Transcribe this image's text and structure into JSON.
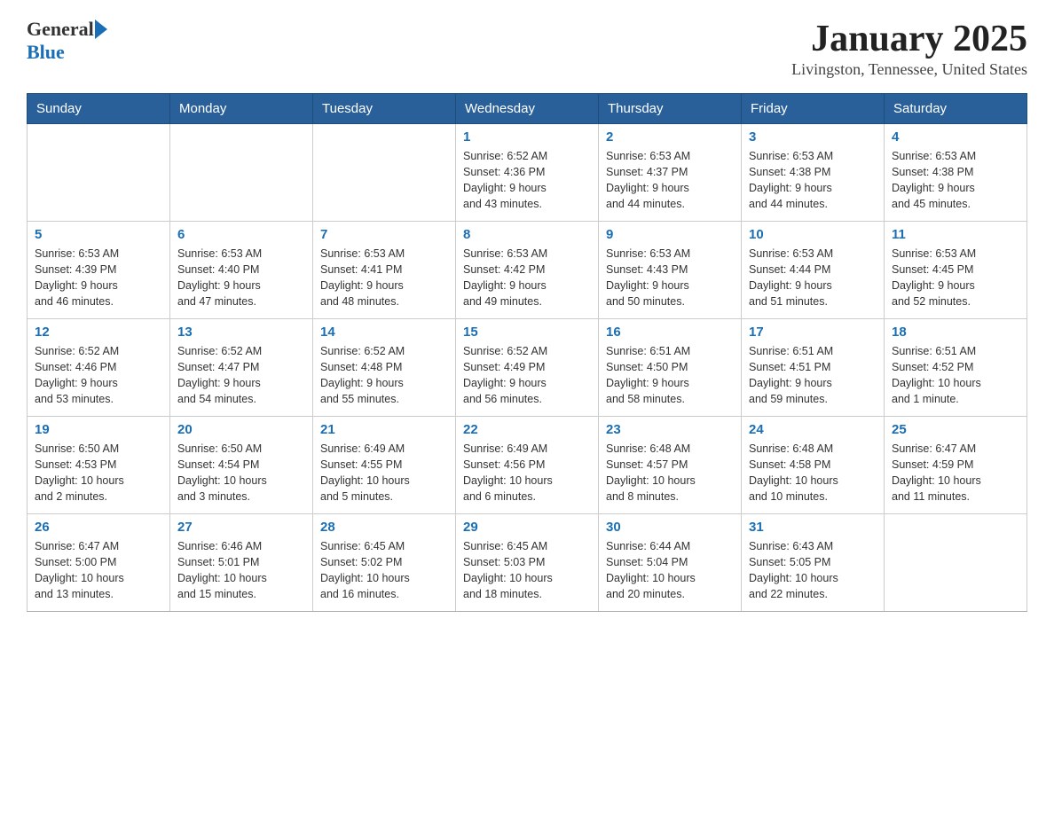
{
  "header": {
    "logo_general": "General",
    "logo_blue": "Blue",
    "title": "January 2025",
    "subtitle": "Livingston, Tennessee, United States"
  },
  "weekdays": [
    "Sunday",
    "Monday",
    "Tuesday",
    "Wednesday",
    "Thursday",
    "Friday",
    "Saturday"
  ],
  "weeks": [
    [
      {
        "day": "",
        "info": ""
      },
      {
        "day": "",
        "info": ""
      },
      {
        "day": "",
        "info": ""
      },
      {
        "day": "1",
        "info": "Sunrise: 6:52 AM\nSunset: 4:36 PM\nDaylight: 9 hours\nand 43 minutes."
      },
      {
        "day": "2",
        "info": "Sunrise: 6:53 AM\nSunset: 4:37 PM\nDaylight: 9 hours\nand 44 minutes."
      },
      {
        "day": "3",
        "info": "Sunrise: 6:53 AM\nSunset: 4:38 PM\nDaylight: 9 hours\nand 44 minutes."
      },
      {
        "day": "4",
        "info": "Sunrise: 6:53 AM\nSunset: 4:38 PM\nDaylight: 9 hours\nand 45 minutes."
      }
    ],
    [
      {
        "day": "5",
        "info": "Sunrise: 6:53 AM\nSunset: 4:39 PM\nDaylight: 9 hours\nand 46 minutes."
      },
      {
        "day": "6",
        "info": "Sunrise: 6:53 AM\nSunset: 4:40 PM\nDaylight: 9 hours\nand 47 minutes."
      },
      {
        "day": "7",
        "info": "Sunrise: 6:53 AM\nSunset: 4:41 PM\nDaylight: 9 hours\nand 48 minutes."
      },
      {
        "day": "8",
        "info": "Sunrise: 6:53 AM\nSunset: 4:42 PM\nDaylight: 9 hours\nand 49 minutes."
      },
      {
        "day": "9",
        "info": "Sunrise: 6:53 AM\nSunset: 4:43 PM\nDaylight: 9 hours\nand 50 minutes."
      },
      {
        "day": "10",
        "info": "Sunrise: 6:53 AM\nSunset: 4:44 PM\nDaylight: 9 hours\nand 51 minutes."
      },
      {
        "day": "11",
        "info": "Sunrise: 6:53 AM\nSunset: 4:45 PM\nDaylight: 9 hours\nand 52 minutes."
      }
    ],
    [
      {
        "day": "12",
        "info": "Sunrise: 6:52 AM\nSunset: 4:46 PM\nDaylight: 9 hours\nand 53 minutes."
      },
      {
        "day": "13",
        "info": "Sunrise: 6:52 AM\nSunset: 4:47 PM\nDaylight: 9 hours\nand 54 minutes."
      },
      {
        "day": "14",
        "info": "Sunrise: 6:52 AM\nSunset: 4:48 PM\nDaylight: 9 hours\nand 55 minutes."
      },
      {
        "day": "15",
        "info": "Sunrise: 6:52 AM\nSunset: 4:49 PM\nDaylight: 9 hours\nand 56 minutes."
      },
      {
        "day": "16",
        "info": "Sunrise: 6:51 AM\nSunset: 4:50 PM\nDaylight: 9 hours\nand 58 minutes."
      },
      {
        "day": "17",
        "info": "Sunrise: 6:51 AM\nSunset: 4:51 PM\nDaylight: 9 hours\nand 59 minutes."
      },
      {
        "day": "18",
        "info": "Sunrise: 6:51 AM\nSunset: 4:52 PM\nDaylight: 10 hours\nand 1 minute."
      }
    ],
    [
      {
        "day": "19",
        "info": "Sunrise: 6:50 AM\nSunset: 4:53 PM\nDaylight: 10 hours\nand 2 minutes."
      },
      {
        "day": "20",
        "info": "Sunrise: 6:50 AM\nSunset: 4:54 PM\nDaylight: 10 hours\nand 3 minutes."
      },
      {
        "day": "21",
        "info": "Sunrise: 6:49 AM\nSunset: 4:55 PM\nDaylight: 10 hours\nand 5 minutes."
      },
      {
        "day": "22",
        "info": "Sunrise: 6:49 AM\nSunset: 4:56 PM\nDaylight: 10 hours\nand 6 minutes."
      },
      {
        "day": "23",
        "info": "Sunrise: 6:48 AM\nSunset: 4:57 PM\nDaylight: 10 hours\nand 8 minutes."
      },
      {
        "day": "24",
        "info": "Sunrise: 6:48 AM\nSunset: 4:58 PM\nDaylight: 10 hours\nand 10 minutes."
      },
      {
        "day": "25",
        "info": "Sunrise: 6:47 AM\nSunset: 4:59 PM\nDaylight: 10 hours\nand 11 minutes."
      }
    ],
    [
      {
        "day": "26",
        "info": "Sunrise: 6:47 AM\nSunset: 5:00 PM\nDaylight: 10 hours\nand 13 minutes."
      },
      {
        "day": "27",
        "info": "Sunrise: 6:46 AM\nSunset: 5:01 PM\nDaylight: 10 hours\nand 15 minutes."
      },
      {
        "day": "28",
        "info": "Sunrise: 6:45 AM\nSunset: 5:02 PM\nDaylight: 10 hours\nand 16 minutes."
      },
      {
        "day": "29",
        "info": "Sunrise: 6:45 AM\nSunset: 5:03 PM\nDaylight: 10 hours\nand 18 minutes."
      },
      {
        "day": "30",
        "info": "Sunrise: 6:44 AM\nSunset: 5:04 PM\nDaylight: 10 hours\nand 20 minutes."
      },
      {
        "day": "31",
        "info": "Sunrise: 6:43 AM\nSunset: 5:05 PM\nDaylight: 10 hours\nand 22 minutes."
      },
      {
        "day": "",
        "info": ""
      }
    ]
  ]
}
